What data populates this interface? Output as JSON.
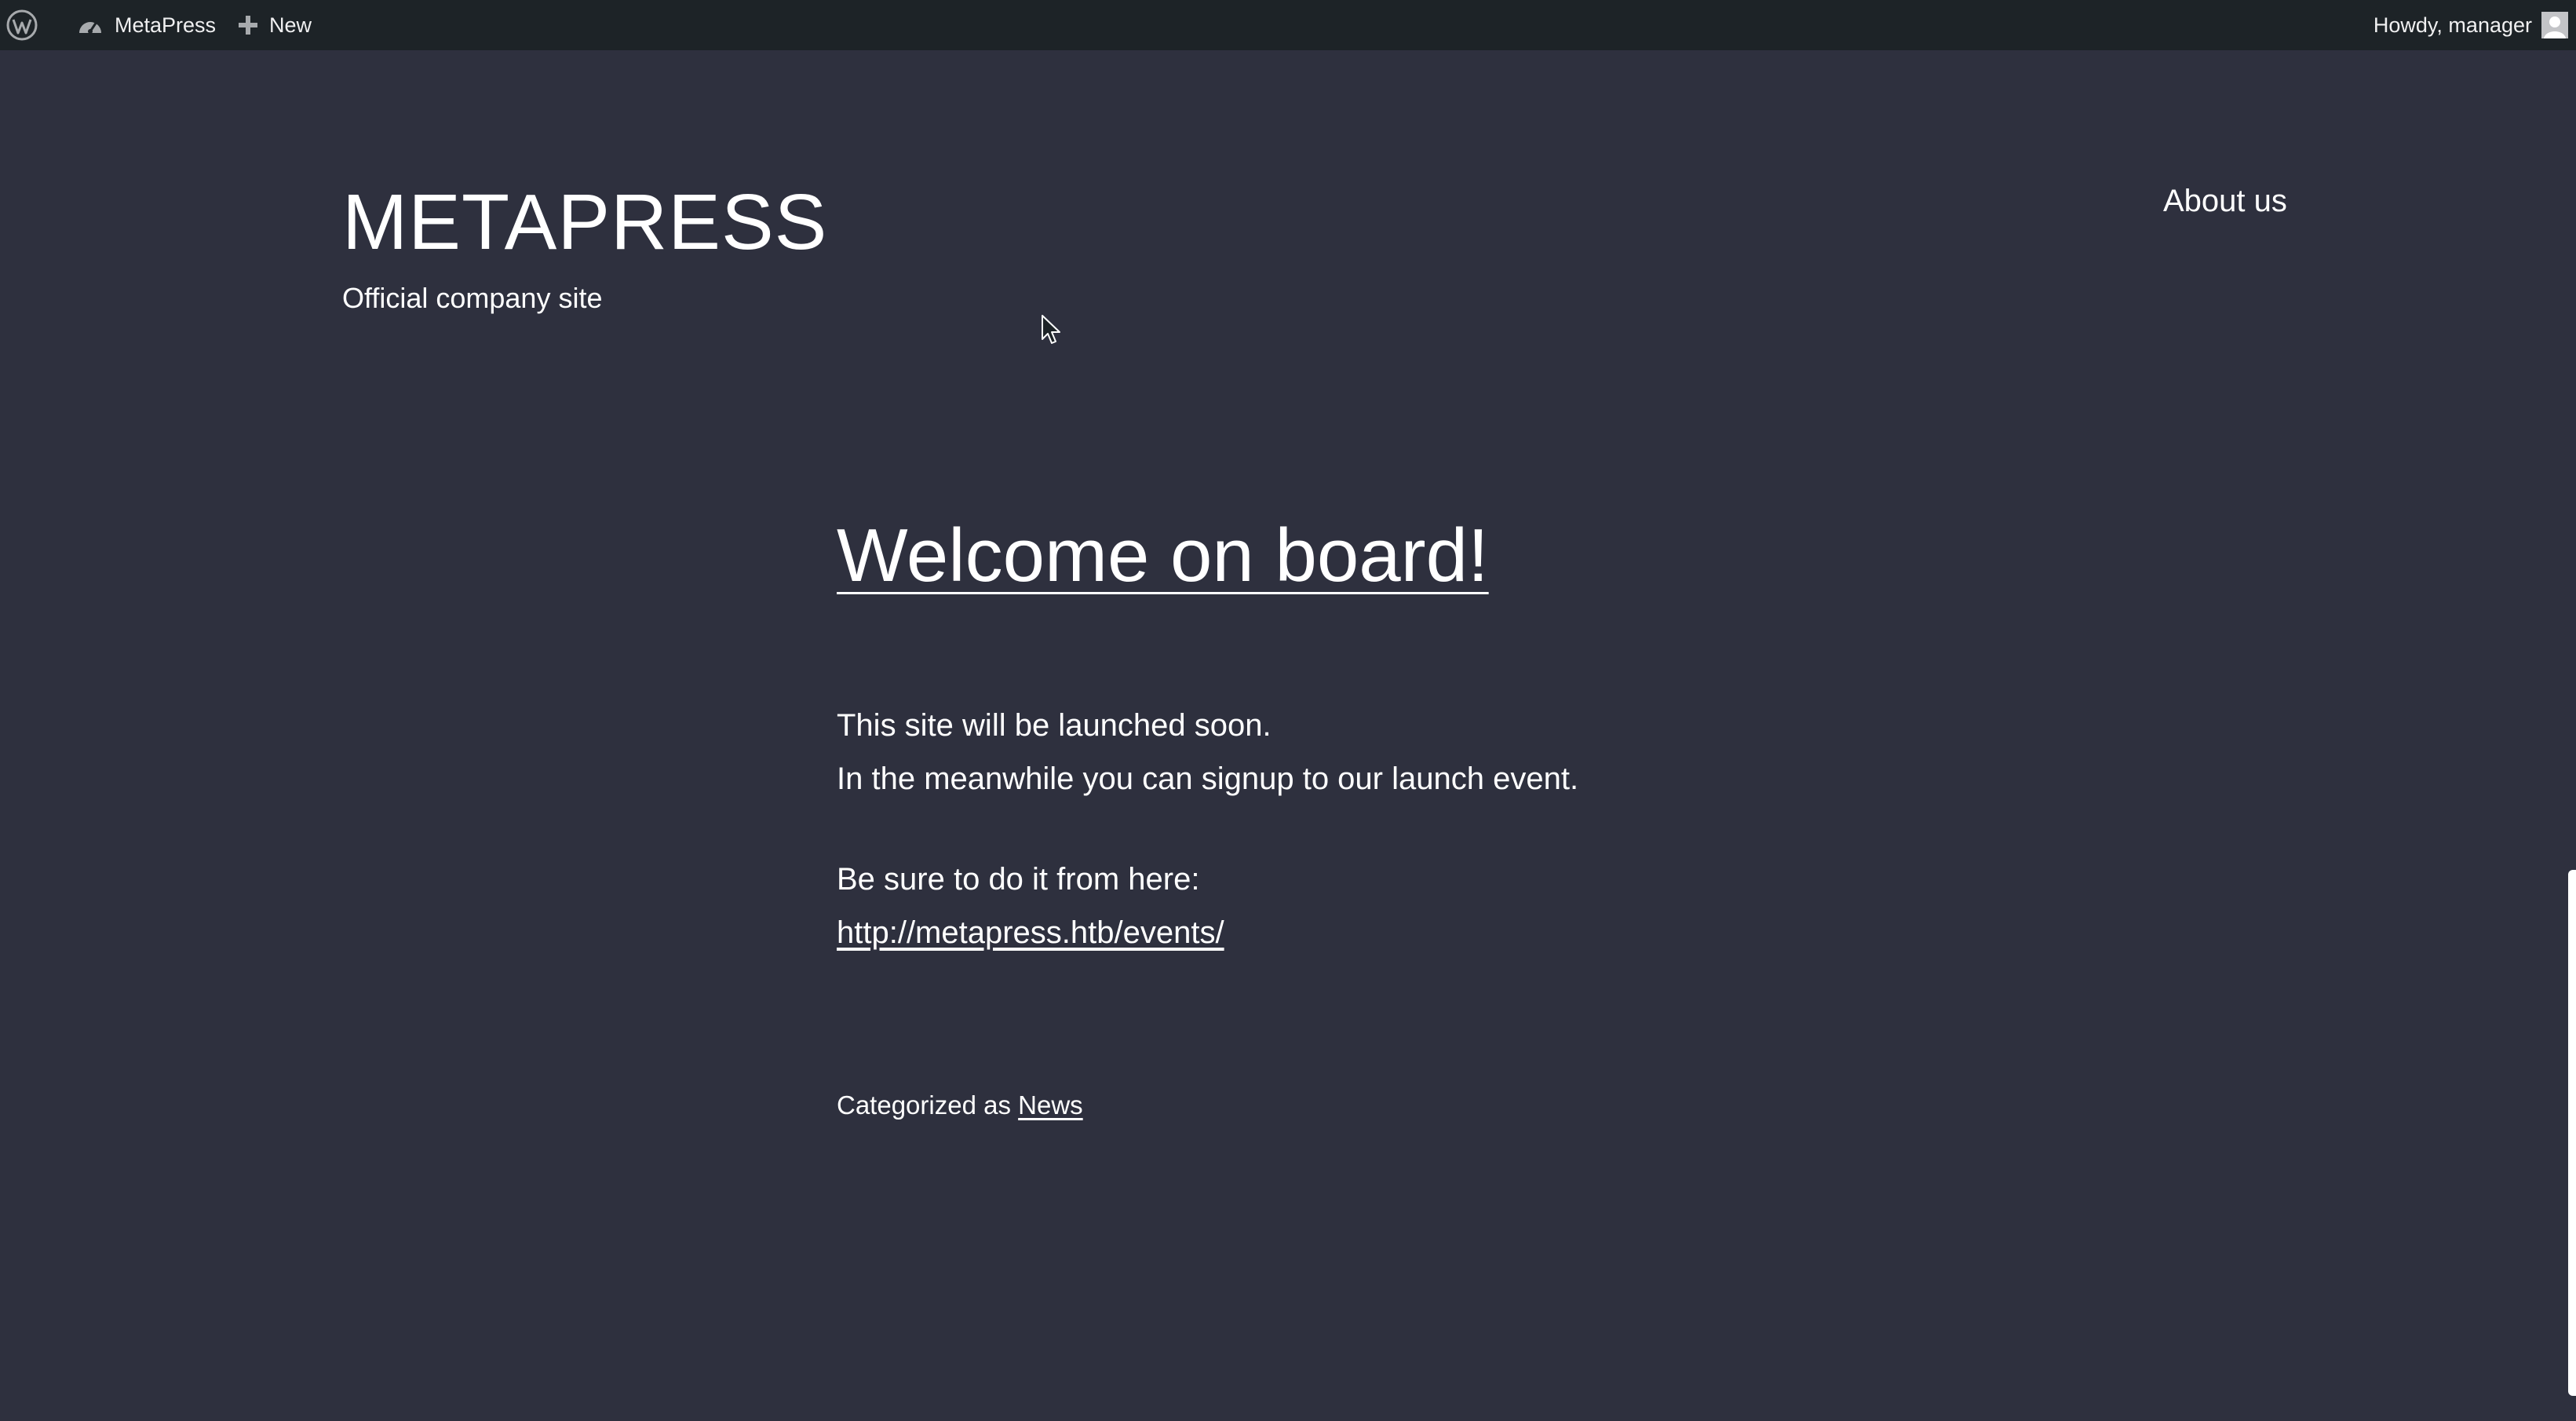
{
  "admin_bar": {
    "site_name": "MetaPress",
    "new_label": "New",
    "howdy": "Howdy, manager",
    "icons": {
      "logo": "wordpress-icon",
      "site": "dashboard-icon",
      "new": "plus-icon",
      "user": "avatar-icon"
    }
  },
  "site": {
    "title": "METAPRESS",
    "tagline": "Official company site",
    "nav": [
      "About us"
    ]
  },
  "post": {
    "title": "Welcome on board!",
    "paragraph1_line1": "This site will be launched soon.",
    "paragraph1_line2": "In the meanwhile you can signup to our launch event.",
    "paragraph2_line1": "Be sure to do it from here:",
    "events_link": "http://metapress.htb/events/",
    "category_prefix": "Categorized as",
    "category": "News"
  },
  "colors": {
    "background": "#2e303e",
    "admin_bar": "#1d2327",
    "text": "#ffffff"
  }
}
